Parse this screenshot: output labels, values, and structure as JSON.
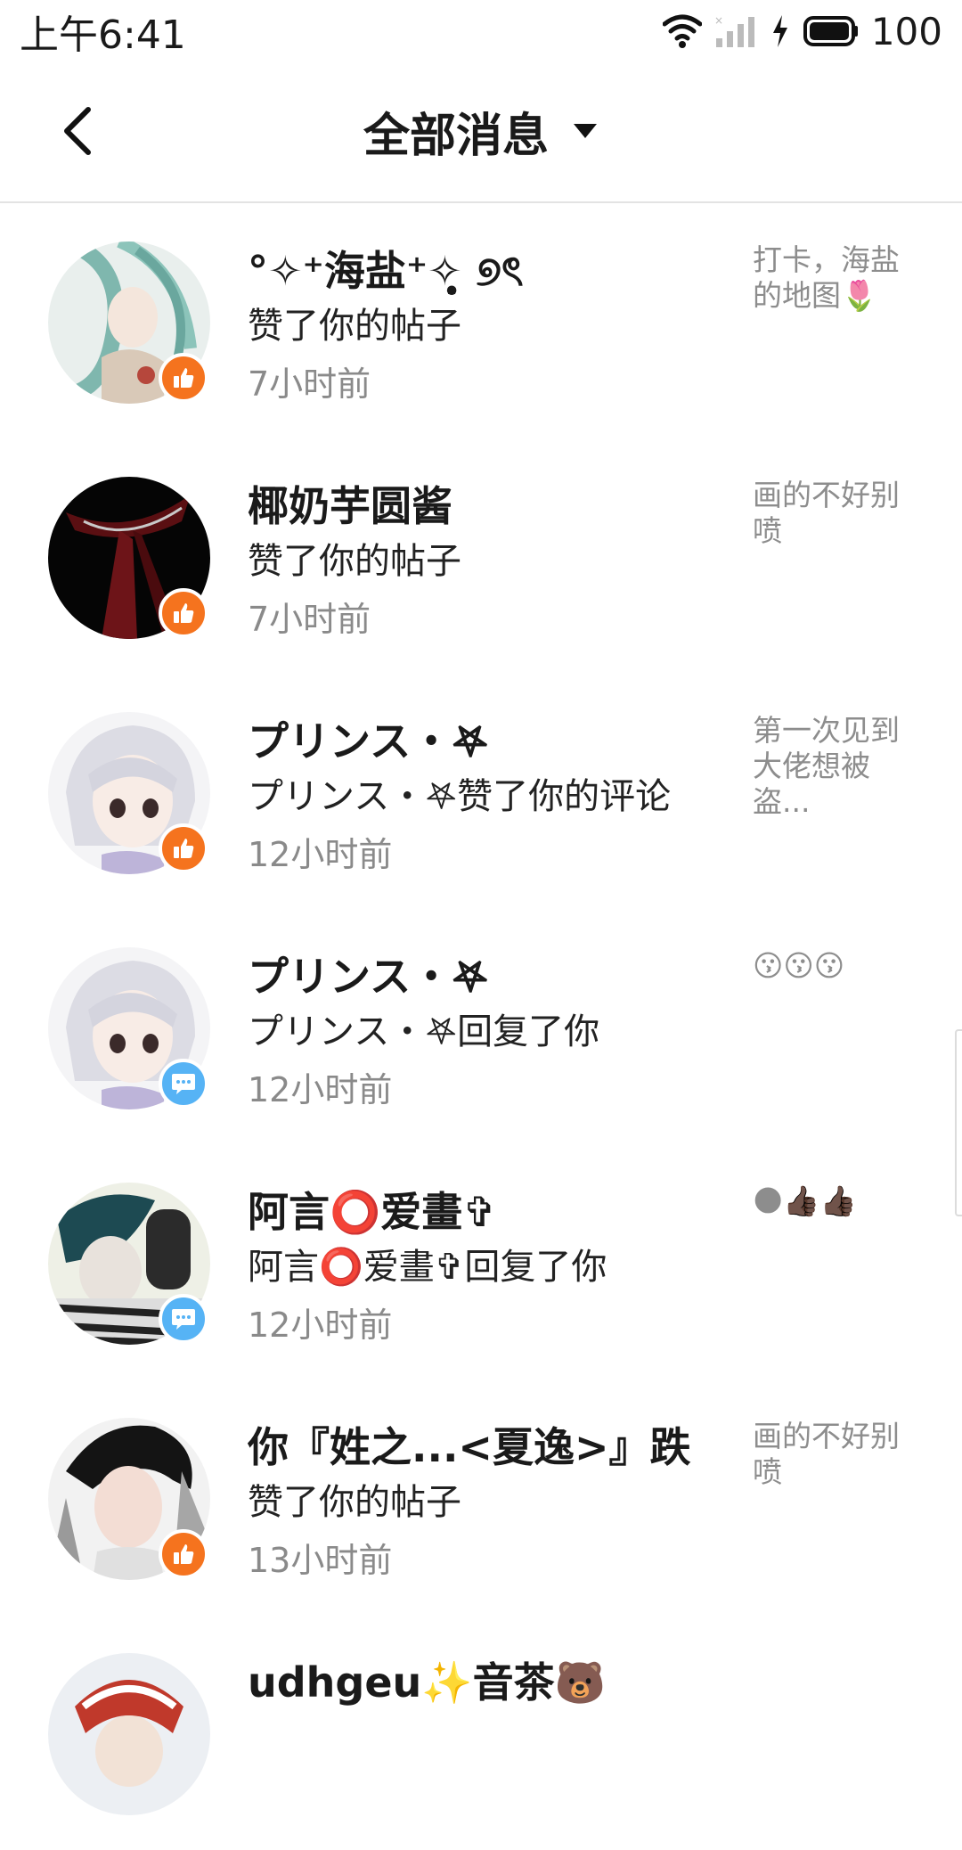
{
  "status_bar": {
    "time": "上午6:41",
    "battery": "100"
  },
  "header": {
    "title": "全部消息"
  },
  "messages": [
    {
      "name": "°✧⁺海盐⁺✧̣̥ ୭ৎ",
      "action": "赞了你的帖子",
      "time": "7小时前",
      "preview": "打卡，海盐的地图🌷",
      "badge": "like",
      "badge_icon": "thumbs-up-icon"
    },
    {
      "name": "椰奶芋圆酱",
      "action": "赞了你的帖子",
      "time": "7小时前",
      "preview": "画的不好别喷",
      "badge": "like",
      "badge_icon": "thumbs-up-icon"
    },
    {
      "name": "プリンス・𖤐",
      "action": "プリンス・𖤐赞了你的评论",
      "time": "12小时前",
      "preview": "第一次见到大佬想被盗...",
      "badge": "like",
      "badge_icon": "thumbs-up-icon"
    },
    {
      "name": "プリンス・𖤐",
      "action": "プリンス・𖤐回复了你",
      "time": "12小时前",
      "preview": "😗😗😗",
      "badge": "reply",
      "badge_icon": "chat-bubble-icon"
    },
    {
      "name": "阿言⭕爱畫✞",
      "action": "阿言⭕爱畫✞回复了你",
      "time": "12小时前",
      "preview": "🌑👍🏿👍🏿",
      "badge": "reply",
      "badge_icon": "chat-bubble-icon"
    },
    {
      "name": "你『姓之...<夏逸>』跌",
      "action": "赞了你的帖子",
      "time": "13小时前",
      "preview": "画的不好别喷",
      "badge": "like",
      "badge_icon": "thumbs-up-icon"
    },
    {
      "name": "udhgeu✨音茶🐻",
      "action": "",
      "time": "",
      "preview": "",
      "badge": "none",
      "badge_icon": ""
    }
  ],
  "colors": {
    "like_badge": "#f5731e",
    "reply_badge": "#56b3f5",
    "secondary_text": "#8a8a8a"
  }
}
